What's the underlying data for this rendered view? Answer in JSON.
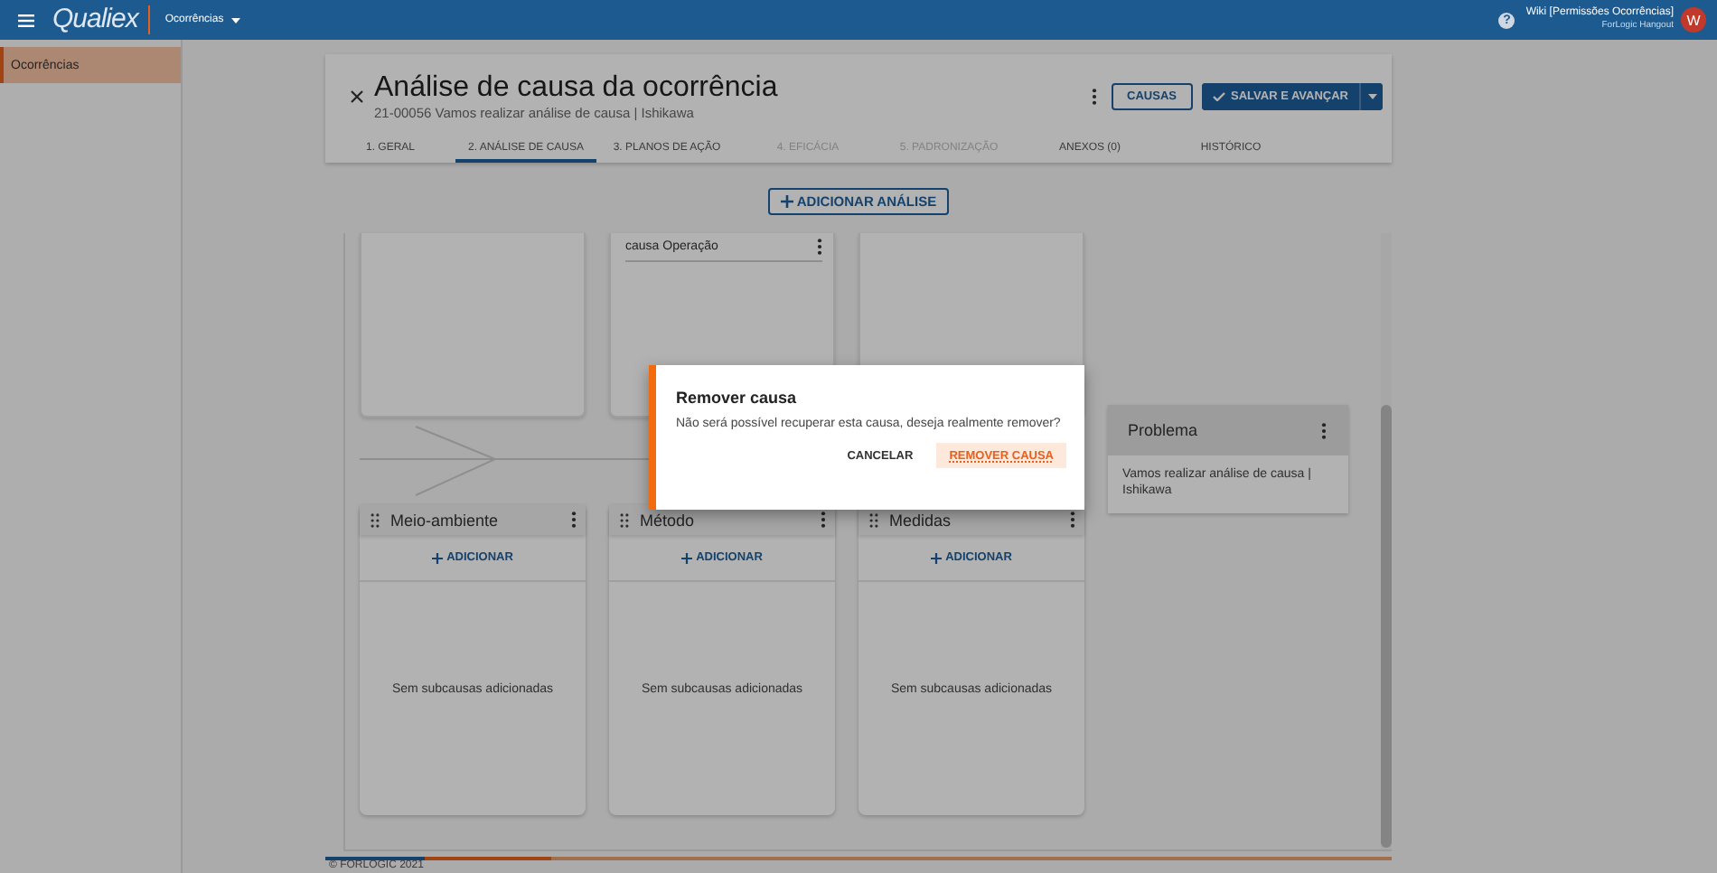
{
  "topbar": {
    "logo": "Qualiex",
    "module": "Ocorrências",
    "user_name": "Wiki [Permissões Ocorrências]",
    "user_org": "ForLogic Hangout",
    "avatar_initial": "W",
    "help": "?"
  },
  "sidebar": {
    "items": [
      {
        "label": "Ocorrências",
        "selected": true
      }
    ]
  },
  "header": {
    "title": "Análise de causa da ocorrência",
    "subtitle": "21-00056 Vamos realizar análise de causa | Ishikawa",
    "causes_button": "CAUSAS",
    "save_button": "SALVAR E AVANÇAR"
  },
  "tabs": [
    {
      "label": "1. GERAL",
      "selected": false,
      "disabled": false
    },
    {
      "label": "2. ANÁLISE DE CAUSA",
      "selected": true,
      "disabled": false
    },
    {
      "label": "3. PLANOS DE AÇÃO",
      "selected": false,
      "disabled": false
    },
    {
      "label": "4. EFICÁCIA",
      "selected": false,
      "disabled": true
    },
    {
      "label": "5. PADRONIZAÇÃO",
      "selected": false,
      "disabled": true
    },
    {
      "label": "ANEXOS (0)",
      "selected": false,
      "disabled": false
    },
    {
      "label": "HISTÓRICO",
      "selected": false,
      "disabled": false
    }
  ],
  "add_analysis_button": "ADICIONAR ANÁLISE",
  "upper_cards": [
    {
      "kind": "empty"
    },
    {
      "kind": "cause",
      "cause": "causa Operação"
    },
    {
      "kind": "empty"
    }
  ],
  "lower_categories": [
    {
      "name": "Meio-ambiente",
      "add_label": "ADICIONAR",
      "empty_text": "Sem subcausas adicionadas"
    },
    {
      "name": "Método",
      "add_label": "ADICIONAR",
      "empty_text": "Sem subcausas adicionadas"
    },
    {
      "name": "Medidas",
      "add_label": "ADICIONAR",
      "empty_text": "Sem subcausas adicionadas"
    }
  ],
  "problem": {
    "title": "Problema",
    "text": "Vamos realizar análise de causa | Ishikawa"
  },
  "dialog": {
    "title": "Remover causa",
    "message": "Não será possível recuperar esta causa, deseja realmente remover?",
    "buttons": [
      {
        "label": "CANCELAR",
        "kind": "plain"
      },
      {
        "label": "REMOVER CAUSA",
        "kind": "primary"
      }
    ]
  },
  "footer": "© FORLOGIC 2021"
}
